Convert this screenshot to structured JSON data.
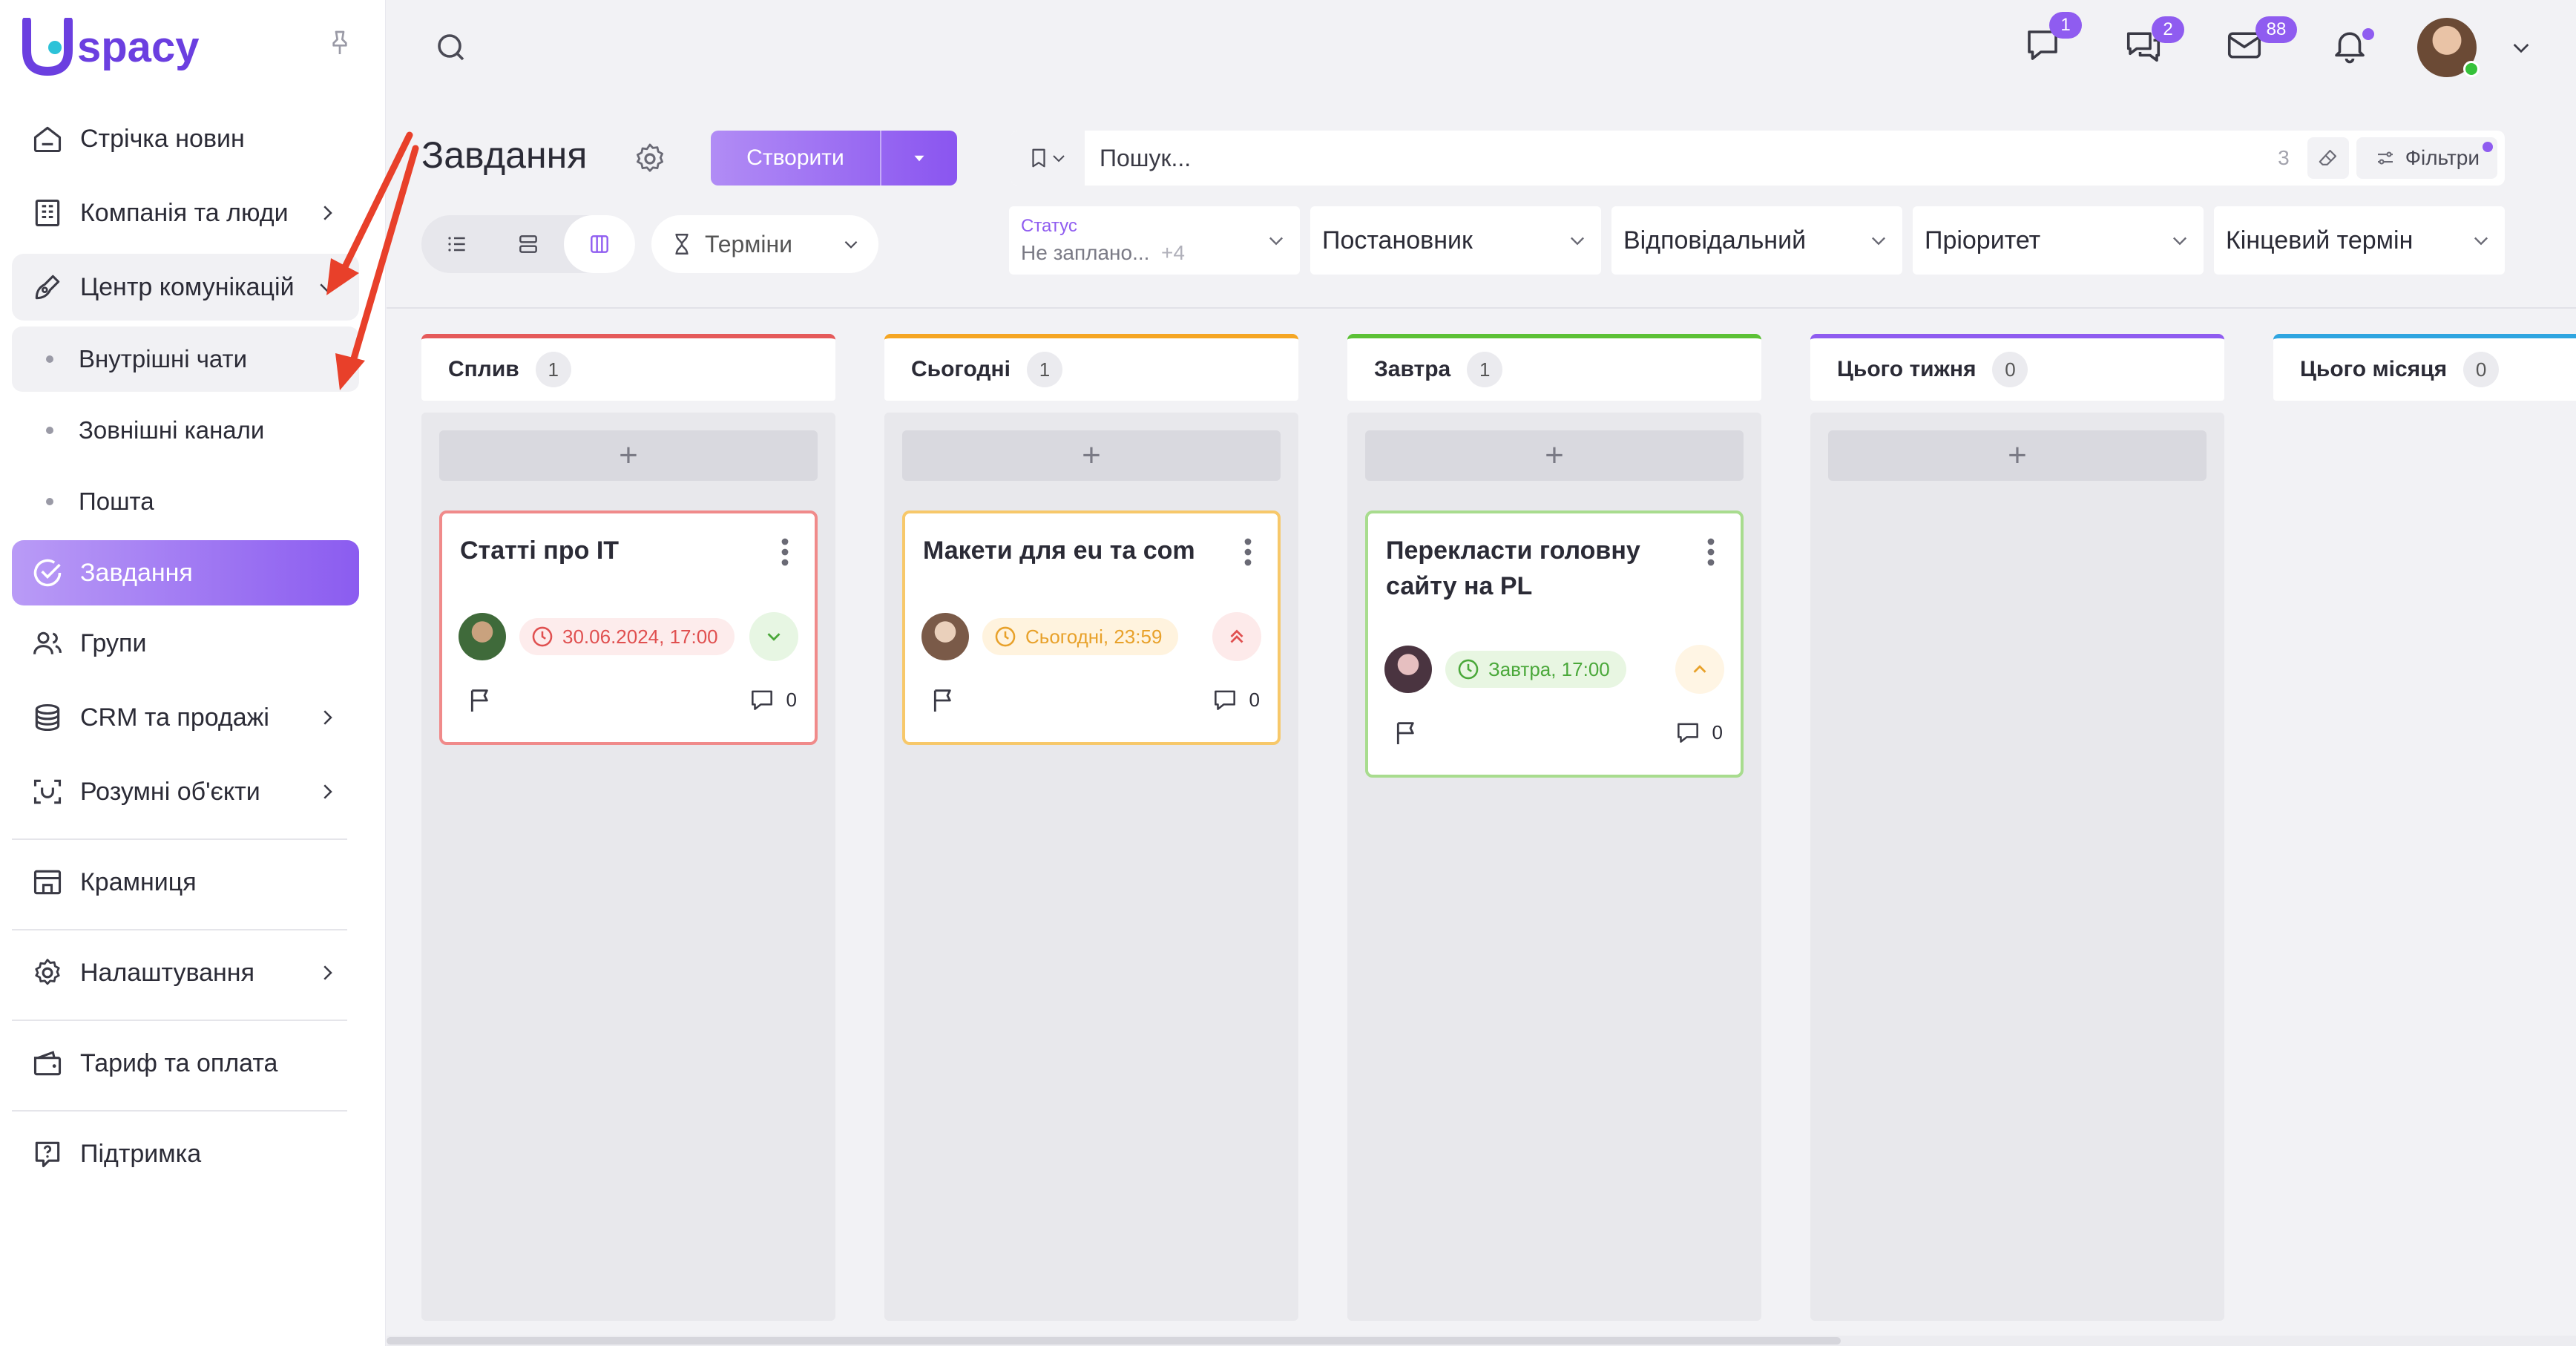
{
  "app": {
    "logo_text": "spacy",
    "logo_letter": "U",
    "brand_color": "#7b4be8"
  },
  "sidebar": {
    "items": [
      {
        "label": "Стрічка новин",
        "icon": "home-icon"
      },
      {
        "label": "Компанія та люди",
        "icon": "building-icon"
      },
      {
        "label": "Центр комунікацій",
        "icon": "chat-edit-icon"
      },
      {
        "label": "Завдання",
        "icon": "check-circle-icon"
      },
      {
        "label": "Групи",
        "icon": "users-icon"
      },
      {
        "label": "CRM та продажі",
        "icon": "coins-icon"
      },
      {
        "label": "Розумні об'єкти",
        "icon": "scan-icon"
      },
      {
        "label": "Крамниця",
        "icon": "store-icon"
      },
      {
        "label": "Налаштування",
        "icon": "gear-icon"
      },
      {
        "label": "Тариф та оплата",
        "icon": "wallet-icon"
      },
      {
        "label": "Підтримка",
        "icon": "help-icon"
      }
    ],
    "sub_items": [
      "Внутрішні чати",
      "Зовнішні канали",
      "Пошта"
    ]
  },
  "topbar": {
    "badges": {
      "chat": "1",
      "messages": "2",
      "mail": "88"
    },
    "bell_dot_color": "#8f5cf0"
  },
  "page": {
    "title": "Завдання",
    "create_label": "Створити",
    "search_placeholder": "Пошук...",
    "search_count": "3",
    "filters_label": "Фільтри",
    "terms_label": "Терміни",
    "status_label": "Статус",
    "status_value": "Не заплано...",
    "status_more": "+4",
    "selects": [
      "Постановник",
      "Відповідальний",
      "Пріоритет",
      "Кінцевий термін"
    ]
  },
  "columns": [
    {
      "name": "Сплив",
      "count": "1",
      "color": "#e55a5a"
    },
    {
      "name": "Сьогодні",
      "count": "1",
      "color": "#f5a623"
    },
    {
      "name": "Завтра",
      "count": "1",
      "color": "#5cc136"
    },
    {
      "name": "Цього тижня",
      "count": "0",
      "color": "#8f5cf0"
    },
    {
      "name": "Цього місяця",
      "count": "0",
      "color": "#2fa5e0"
    }
  ],
  "cards": [
    {
      "title": "Статті про IT",
      "due": "30.06.2024, 17:00",
      "comments": "0",
      "priority": "low"
    },
    {
      "title": "Макети для eu та com",
      "due": "Сьогодні, 23:59",
      "comments": "0",
      "priority": "high"
    },
    {
      "title": "Перекласти головну сайту на PL",
      "due": "Завтра, 17:00",
      "comments": "0",
      "priority": "medium"
    }
  ]
}
